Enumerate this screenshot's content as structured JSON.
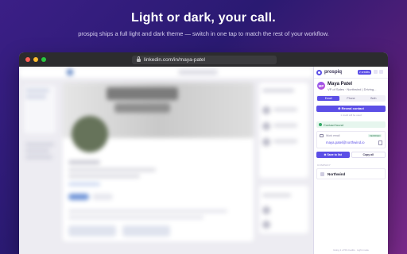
{
  "headline": "Light or dark, your call.",
  "subhead": "prospiq ships a full light and dark theme — switch in one tap to match the rest of your workflow.",
  "browser": {
    "url": "linkedin.com/in/maya-patel"
  },
  "panel": {
    "brand": "prospiq",
    "credits_badge": "2 credits",
    "profile": {
      "initials": "MP",
      "name": "Maya Patel",
      "title": "VP of Sales · Northwind | Driving..."
    },
    "tabs": [
      "Email",
      "Phone",
      "Both"
    ],
    "active_tab": "Email",
    "reveal_label": "⊕ Reveal contact",
    "reveal_hint": "1 credit will be used",
    "found_label": "Contact found",
    "email": {
      "label": "Work email",
      "status": "VERIFIED",
      "value": "maya.patel@northwind.io"
    },
    "actions": {
      "save_label": "⊕ Save to list",
      "copy_label": "Copy all"
    },
    "company_section_label": "COMPANY",
    "company_name": "Northwind",
    "footer": "Using 1 of 50 credits · Light mode"
  },
  "colors": {
    "accent": "#5b4ee6",
    "success": "#34a866",
    "background_top": "#3b1f86",
    "background_bottom": "#7a2a8a"
  }
}
